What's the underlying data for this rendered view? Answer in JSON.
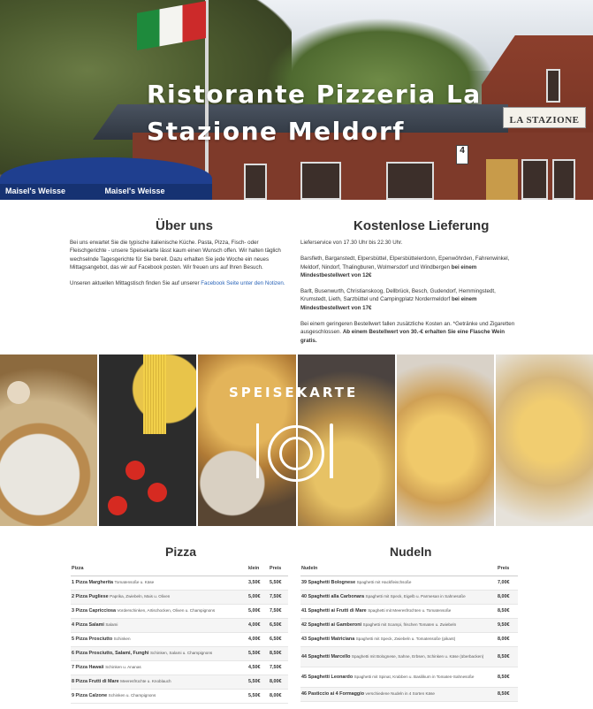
{
  "hero": {
    "title": "Ristorante Pizzeria La Stazione Meldorf",
    "sign_text": "LA STAZIONE",
    "umbrella_text_1": "Maisel's Weisse",
    "umbrella_text_2": "Maisel's Weisse",
    "badge": "4"
  },
  "about": {
    "title": "Über uns",
    "p1": "Bei uns erwartet Sie die typische italienische Küche. Pasta, Pizza, Fisch- oder Fleischgerichte - unsere Speisekarte lässt kaum einen Wunsch offen. Wir halten täglich wechselnde Tagesgerichte für Sie bereit. Dazu erhalten Sie jede Woche ein neues Mittagsangebot, das wir auf Facebook posten. Wir freuen uns auf Ihren Besuch.",
    "p2_text": "Unseren aktuellen Mittagstisch finden Sie auf unserer",
    "p2_link": "Facebook Seite unter den Notizen."
  },
  "delivery": {
    "title": "Kostenlose Lieferung",
    "p1": "Lieferservice von 17.30 Uhr bis 22.30 Uhr.",
    "p2_text": "Barsfleth, Barganstedt, Elpersbüttel, Elpersbüttelerdonn, Epenwöhrden, Fahrenwinkel, Meldorf, Nindorf, Thalingburen, Wolmersdorf und Windbergen",
    "p2_bold": "bei einem Mindestbestellwert von 12€",
    "p3_text": "Barlt, Busenwurth, Christianskoog, Dellbrück, Besch, Gudendorf, Hemmingstedt, Krumstedt, Lieth, Sarzbüttel und Campingplatz Nordermeldorf",
    "p3_bold": "bei einem Mindestbestellwert von 17€",
    "p4_text": "Bei einem geringeren Bestellwert fallen zusätzliche Kosten an. *Getränke und Zigaretten ausgeschlossen.",
    "p4_bold": "Ab einem Bestellwert von 30.-€ erhalten Sie eine Flasche Wein gratis."
  },
  "menu_banner": {
    "title": "SPEISEKARTE"
  },
  "pizza": {
    "title": "Pizza",
    "headers": [
      "Pizza",
      "klein",
      "Preis"
    ],
    "rows": [
      {
        "name": "1 Pizza Margherita",
        "desc": "Tomatensoße u. Käse",
        "small": "3,50€",
        "price": "5,50€"
      },
      {
        "name": "2 Pizza Pugliese",
        "desc": "Paprika, Zwiebeln, Mais u. Oliven",
        "small": "5,00€",
        "price": "7,50€"
      },
      {
        "name": "3 Pizza Capricciosa",
        "desc": "Vorderschinken, Artischocken, Oliven u. Champignons",
        "small": "5,00€",
        "price": "7,50€"
      },
      {
        "name": "4 Pizza Salami",
        "desc": "Salami",
        "small": "4,00€",
        "price": "6,50€"
      },
      {
        "name": "5 Pizza Prosciutto",
        "desc": "Schinken",
        "small": "4,00€",
        "price": "6,50€"
      },
      {
        "name": "6 Pizza Prosciutto, Salami, Funghi",
        "desc": "Schinken, Salami u. Champignons",
        "small": "5,50€",
        "price": "8,50€"
      },
      {
        "name": "7 Pizza Hawaii",
        "desc": "Schinken u. Ananas",
        "small": "4,50€",
        "price": "7,50€"
      },
      {
        "name": "8 Pizza Frutti di Mare",
        "desc": "Meeresfrüchte u. Knoblauch",
        "small": "5,50€",
        "price": "8,00€"
      },
      {
        "name": "9 Pizza Calzone",
        "desc": "Schinken u. Champignons",
        "small": "5,50€",
        "price": "8,00€"
      }
    ]
  },
  "nudeln": {
    "title": "Nudeln",
    "headers": [
      "Nudeln",
      "Preis"
    ],
    "rows": [
      {
        "name": "39 Spaghetti Bolognese",
        "desc": "Spaghetti mit Hackfleischsoße",
        "price": "7,00€"
      },
      {
        "name": "40 Spaghetti alla Carbonara",
        "desc": "Spaghetti mit Speck, Eigelb u. Parmesan in Sahnesoße",
        "price": "8,00€"
      },
      {
        "name": "41 Spaghetti ai Frutti di Mare",
        "desc": "Spaghetti mit Meeresfrüchten u. Tomatensoße",
        "price": "8,50€"
      },
      {
        "name": "42 Spaghetti ai Gamberoni",
        "desc": "Spaghetti mit Scampi, frischen Tomaten u. Zwiebeln",
        "price": "9,50€"
      },
      {
        "name": "43 Spaghetti Matriciana",
        "desc": "Spaghetti mit Speck, Zwiebeln u. Tomatensoße (pikant)",
        "price": "8,00€"
      },
      {
        "name": "44 Spaghetti Marcello",
        "desc": "Spaghetti mit Bolognese, Sahne, Erbsen, Schinken u. Käse (überbacken)",
        "price": "8,50€"
      },
      {
        "name": "45 Spaghetti Leonardo",
        "desc": "Spaghetti mit Spinat, Krabben u. Basilikum in Tomaten-Sahnesoße",
        "price": "8,50€"
      },
      {
        "name": "46 Pasticcio ai 4 Formaggio",
        "desc": "verschiedene Nudeln in 4 Sorten Käse",
        "price": "8,50€"
      }
    ]
  }
}
